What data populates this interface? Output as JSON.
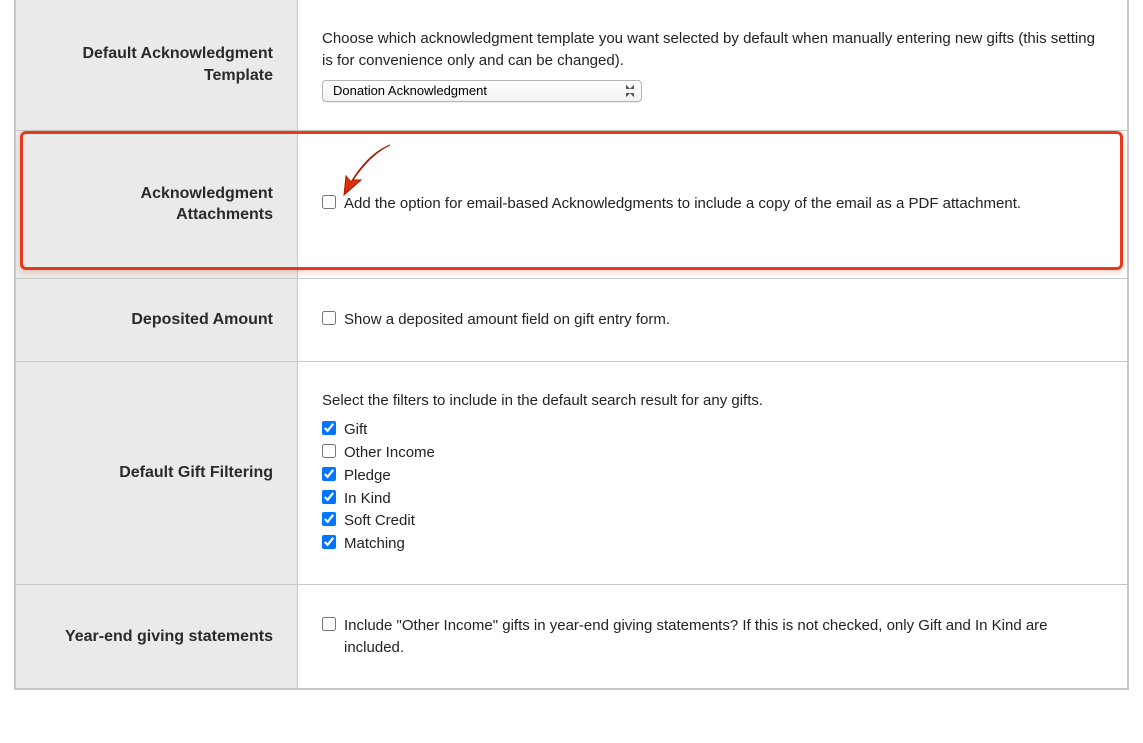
{
  "rows": {
    "default_ack_template": {
      "label": "Default Acknowledgment Template",
      "desc": "Choose which acknowledgment template you want selected by default when manually entering new gifts (this setting is for convenience only and can be changed).",
      "selected": "Donation Acknowledgment"
    },
    "ack_attachments": {
      "label": "Acknowledgment Attachments",
      "checkbox_label": "Add the option for email-based Acknowledgments to include a copy of the email as a PDF attachment."
    },
    "deposited_amount": {
      "label": "Deposited Amount",
      "checkbox_label": "Show a deposited amount field on gift entry form."
    },
    "default_gift_filtering": {
      "label": "Default Gift Filtering",
      "desc": "Select the filters to include in the default search result for any gifts.",
      "filters": [
        {
          "label": "Gift",
          "checked": true
        },
        {
          "label": "Other Income",
          "checked": false
        },
        {
          "label": "Pledge",
          "checked": true
        },
        {
          "label": "In Kind",
          "checked": true
        },
        {
          "label": "Soft Credit",
          "checked": true
        },
        {
          "label": "Matching",
          "checked": true
        }
      ]
    },
    "year_end": {
      "label": "Year-end giving statements",
      "checkbox_label": "Include \"Other Income\" gifts in year-end giving statements? If this is not checked, only Gift and In Kind are included."
    }
  }
}
